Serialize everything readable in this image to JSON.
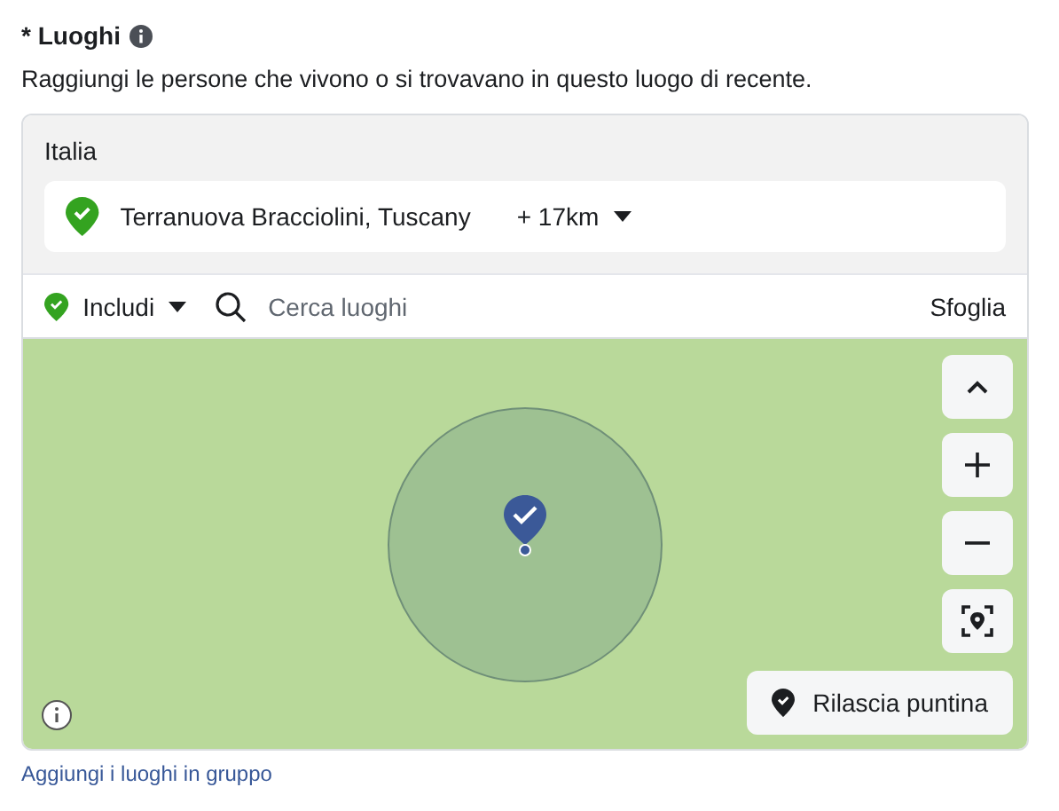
{
  "section": {
    "label": "* Luoghi",
    "description": "Raggiungi le persone che vivono o si trovavano in questo luogo di recente."
  },
  "location_panel": {
    "country": "Italia",
    "locations": [
      {
        "name": "Terranuova Bracciolini, Tuscany",
        "radius": "+ 17km"
      }
    ]
  },
  "toolbar": {
    "mode": "Includi",
    "search": {
      "placeholder": "Cerca luoghi"
    },
    "browse": "Sfoglia"
  },
  "map": {
    "drop_pin": "Rilascia puntina"
  },
  "bulk_link": "Aggiungi i luoghi in gruppo"
}
